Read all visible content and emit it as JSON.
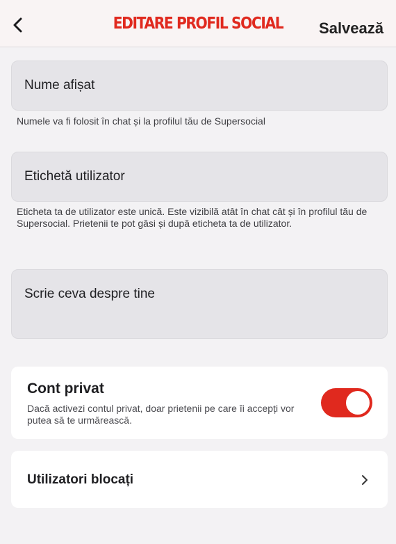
{
  "header": {
    "back_icon": "chevron-left-icon",
    "title": "EDITARE PROFIL SOCIAL",
    "save_label": "Salvează"
  },
  "fields": {
    "display_name": {
      "placeholder": "Nume afișat",
      "value": "",
      "hint": "Numele va fi folosit în chat și la profilul tău de Supersocial"
    },
    "user_tag": {
      "placeholder": "Etichetă utilizator",
      "value": "",
      "hint": "Eticheta ta de utilizator este unică. Este vizibilă atât în chat cât și în profilul tău de Supersocial. Prietenii te pot găsi și după eticheta ta de utilizator."
    },
    "bio": {
      "placeholder": "Scrie ceva despre tine",
      "value": ""
    }
  },
  "private_account": {
    "title": "Cont privat",
    "description": "Dacă activezi contul privat, doar prietenii pe care îi accepți vor putea să te urmărească.",
    "enabled": true
  },
  "blocked_users": {
    "label": "Utilizatori blocați",
    "chevron_icon": "chevron-right-icon"
  },
  "colors": {
    "accent": "#e0291e",
    "background": "#f3f2f4",
    "field_background": "#e5e4e8"
  }
}
